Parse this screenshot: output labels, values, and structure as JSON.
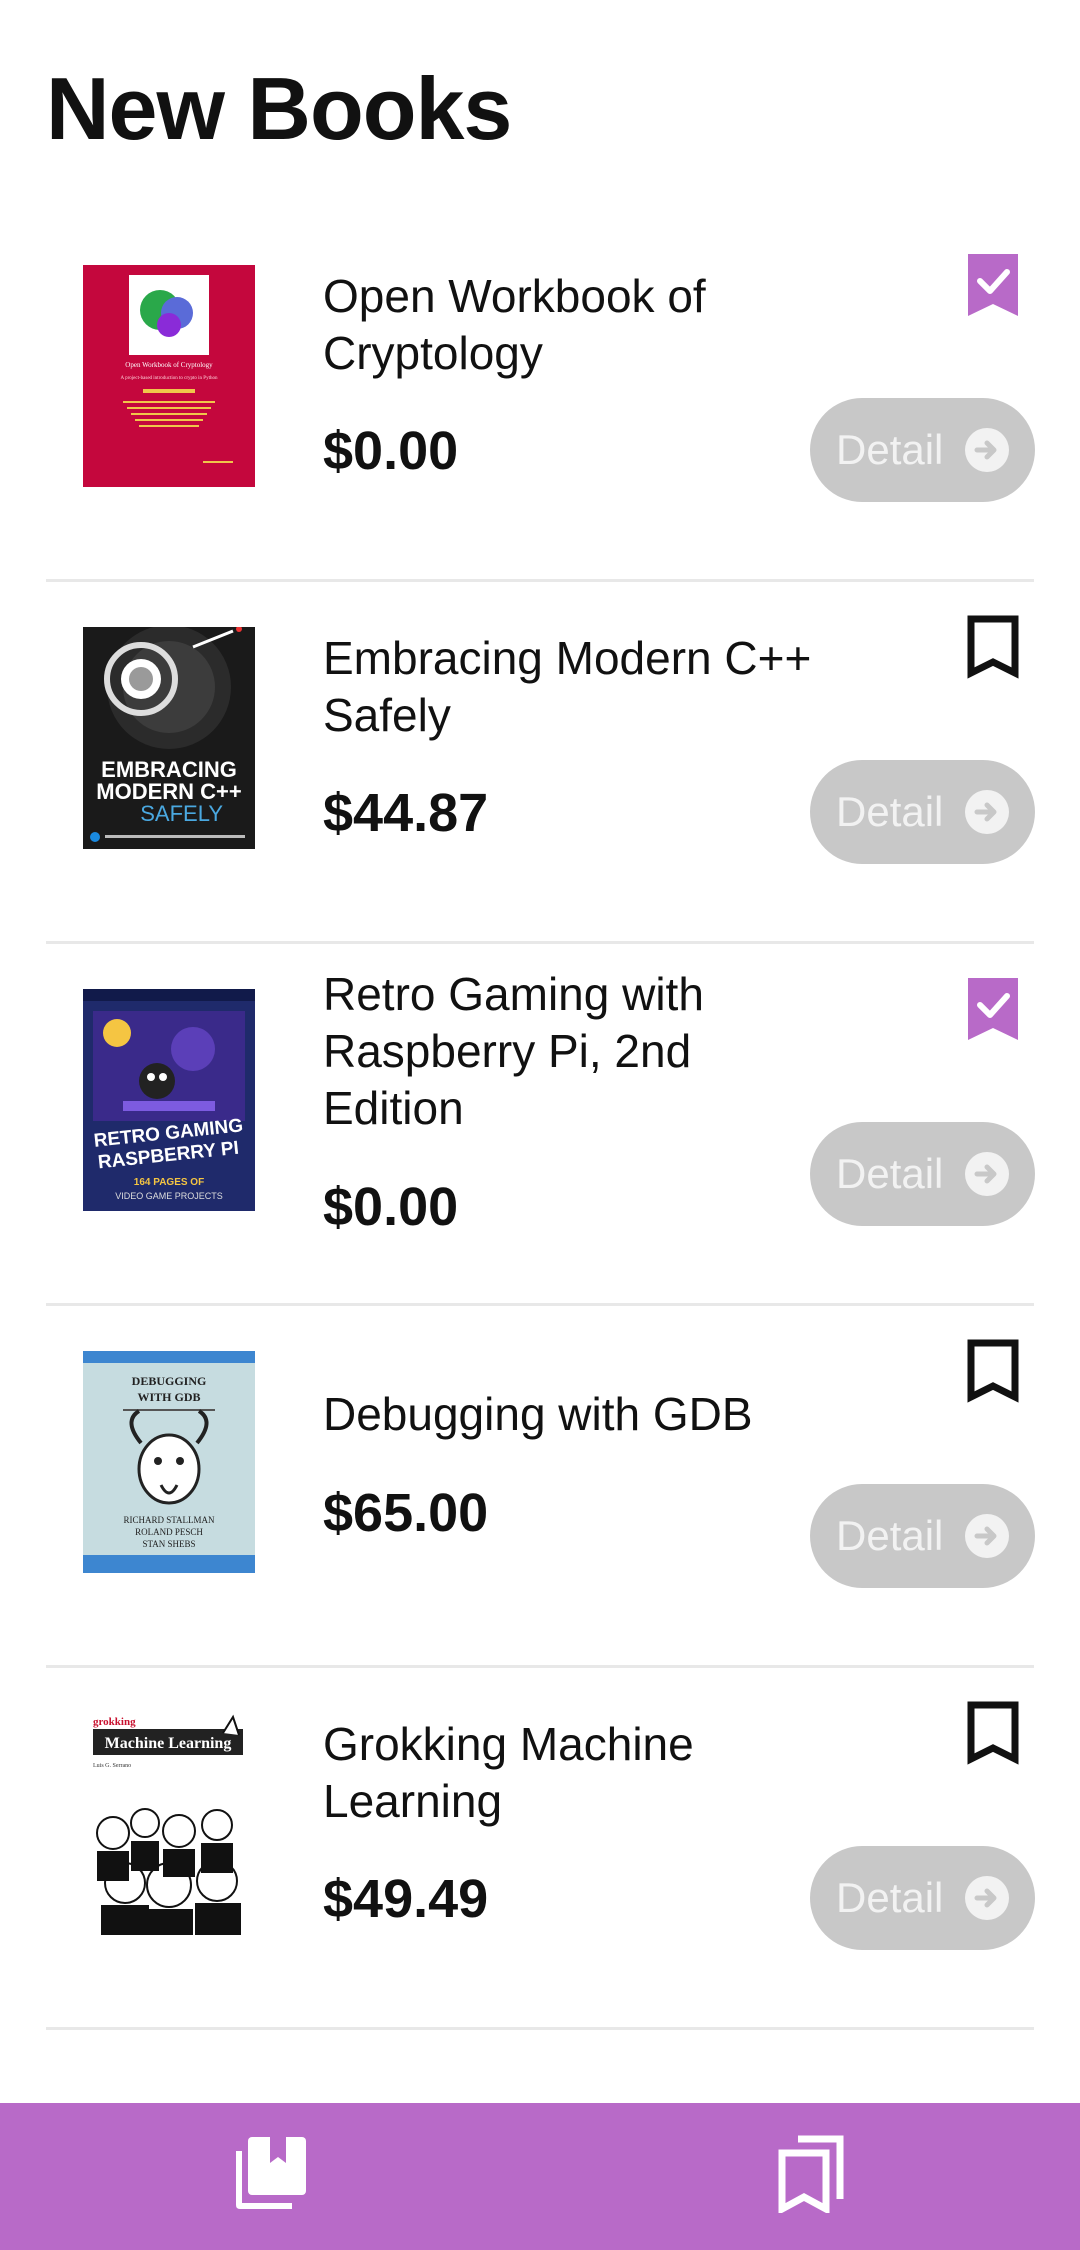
{
  "page": {
    "title": "New Books"
  },
  "colors": {
    "accent": "#b86ac8",
    "button_bg": "#c8c8c8",
    "button_text": "#f2f2f2",
    "divider": "#e8e8e8"
  },
  "books": [
    {
      "title": "Open Workbook of Cryptology",
      "price": "$0.00",
      "bookmarked": true,
      "detail_label": "Detail",
      "cover": "cryptology-cover",
      "cover_text": [
        "Open Workbook of Cryptology",
        "A project-based introduction to crypto in Python"
      ]
    },
    {
      "title": "Embracing Modern C++ Safely",
      "price": "$44.87",
      "bookmarked": false,
      "detail_label": "Detail",
      "cover": "cpp-cover",
      "cover_text": [
        "EMBRACING",
        "MODERN C++",
        "SAFELY"
      ]
    },
    {
      "title": "Retro Gaming with Raspberry Pi, 2nd Edition",
      "price": "$0.00",
      "bookmarked": true,
      "detail_label": "Detail",
      "cover": "retro-gaming-cover",
      "cover_text": [
        "RETRO GAMING",
        "RASPBERRY PI",
        "164 PAGES OF",
        "VIDEO GAME PROJECTS"
      ]
    },
    {
      "title": "Debugging with GDB",
      "price": "$65.00",
      "bookmarked": false,
      "detail_label": "Detail",
      "cover": "gdb-cover",
      "cover_text": [
        "DEBUGGING",
        "WITH GDB",
        "RICHARD STALLMAN",
        "ROLAND PESCH",
        "STAN SHEBS"
      ]
    },
    {
      "title": "Grokking Machine Learning",
      "price": "$49.49",
      "bookmarked": false,
      "detail_label": "Detail",
      "cover": "grokking-ml-cover",
      "cover_text": [
        "grokking",
        "Machine Learning",
        "Luis G. Serrano"
      ]
    }
  ],
  "bottom_nav": {
    "items": [
      {
        "name": "new-books",
        "icon": "library-books-icon"
      },
      {
        "name": "bookmarks",
        "icon": "bookmarks-icon"
      }
    ]
  }
}
